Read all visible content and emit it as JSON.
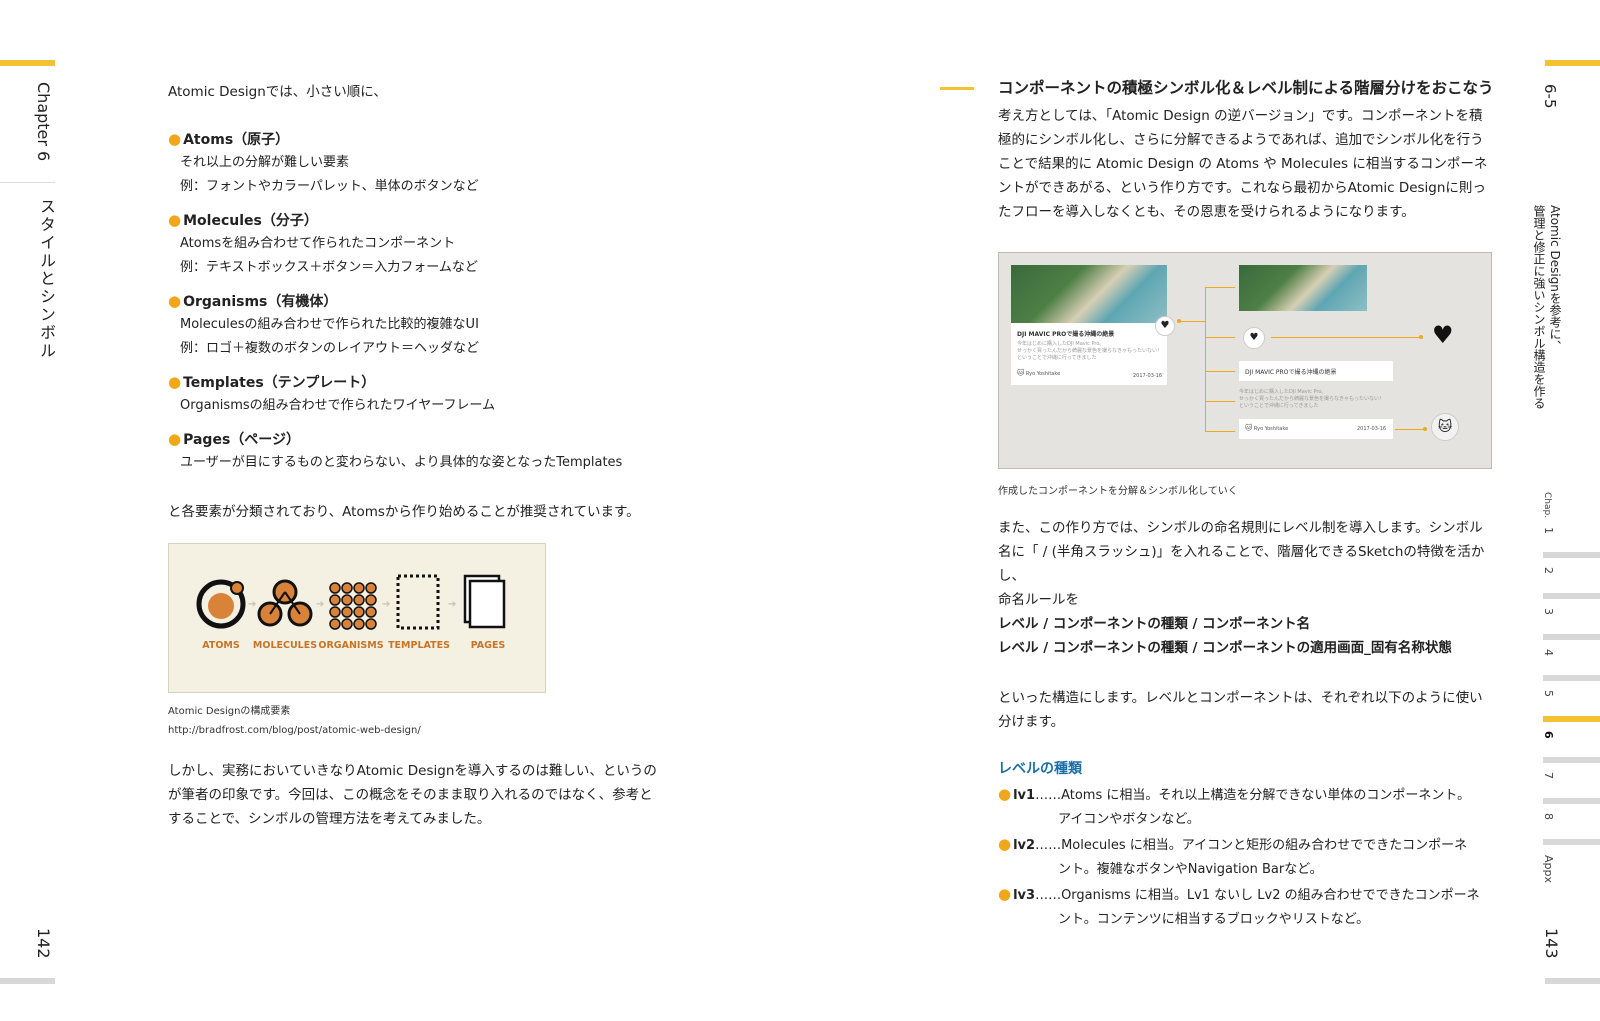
{
  "left_margin": {
    "chapter_label": "Chapter 6",
    "chapter_title": "スタイルとシンボル",
    "page_number": "142"
  },
  "left_page": {
    "intro": "Atomic Designでは、小さい順に、",
    "items": [
      {
        "head": "Atoms（原子）",
        "lines": [
          "それ以上の分解が難しい要素",
          "例：フォントやカラーパレット、単体のボタンなど"
        ]
      },
      {
        "head": "Molecules（分子）",
        "lines": [
          "Atomsを組み合わせて作られたコンポーネント",
          "例：テキストボックス＋ボタン＝入力フォームなど"
        ]
      },
      {
        "head": "Organisms（有機体）",
        "lines": [
          "Moleculesの組み合わせで作られた比較的複雑なUI",
          "例：ロゴ＋複数のボタンのレイアウト＝ヘッダなど"
        ]
      },
      {
        "head": "Templates（テンプレート）",
        "lines": [
          "Organismsの組み合わせで作られたワイヤーフレーム"
        ]
      },
      {
        "head": "Pages（ページ）",
        "lines": [
          "ユーザーが目にするものと変わらない、より具体的な姿となったTemplates"
        ]
      }
    ],
    "summary": "と各要素が分類されており、Atomsから作り始めることが推奨されています。",
    "figure_labels": [
      "ATOMS",
      "MOLECULES",
      "ORGANISMS",
      "TEMPLATES",
      "PAGES"
    ],
    "caption_1": "Atomic Designの構成要素",
    "caption_2": "http://bradfrost.com/blog/post/atomic-web-design/",
    "closing": [
      "しかし、実務においていきなりAtomic Designを導入するのは難しい、というの",
      "が筆者の印象です。今回は、この概念をそのまま取り入れるのではなく、参考と",
      "することで、シンボルの管理方法を考えてみました。"
    ]
  },
  "right_page": {
    "heading": "コンポーネントの積極シンボル化＆レベル制による階層分けをおこなう",
    "para1": [
      "考え方としては、「Atomic Design の逆バージョン」です。コンポーネントを積",
      "極的にシンボル化し、さらに分解できるようであれば、追加でシンボル化を行う",
      "ことで結果的に Atomic Design の Atoms や Molecules に相当するコンポーネ",
      "ントができあがる、という作り方です。これなら最初からAtomic Designに則っ",
      "たフローを導入しなくとも、その恩恵を受けられるようになります。"
    ],
    "figure": {
      "card_title": "DJI MAVIC PROで撮る沖縄の絶景",
      "card_body": [
        "今年はじめに購入したDJI Mavic Pro。",
        "せっかく買ったんだから綺麗な景色を撮らなきゃもったいない！",
        "ということで沖縄に行ってきました"
      ],
      "author": "Ryo Yoshitake",
      "date": "2017-03-16"
    },
    "fig_caption": "作成したコンポーネントを分解＆シンボル化していく",
    "para2": [
      "また、この作り方では、シンボルの命名規則にレベル制を導入します。シンボル",
      "名に「 / (半角スラッシュ)」を入れることで、階層化できるSketchの特徴を活かし、",
      "命名ルールを"
    ],
    "naming": [
      "レベル / コンポーネントの種類 / コンポーネント名",
      "レベル / コンポーネントの種類 / コンポーネントの適用画面_固有名称状態"
    ],
    "para3": [
      "といった構造にします。レベルとコンポーネントは、それぞれ以下のように使い",
      "分けます。"
    ],
    "levels_heading": "レベルの種類",
    "levels": [
      {
        "key": "lv1",
        "lines": [
          "……Atoms に相当。それ以上構造を分解できない単体のコンポーネント。",
          "アイコンやボタンなど。"
        ]
      },
      {
        "key": "lv2",
        "lines": [
          "……Molecules に相当。アイコンと矩形の組み合わせでできたコンポーネ",
          "ント。複雑なボタンやNavigation Barなど。"
        ]
      },
      {
        "key": "lv3",
        "lines": [
          "……Organisms に相当。Lv1 ないし Lv2 の組み合わせでできたコンポーネ",
          "ント。コンテンツに相当するブロックやリストなど。"
        ]
      }
    ]
  },
  "right_margin": {
    "section": "6-5",
    "title": [
      "Atomic Designを参考に、",
      "管理と修正に強いシンボル構造を作る"
    ],
    "chap_label": "Chap.",
    "chapters": [
      "1",
      "2",
      "3",
      "4",
      "5",
      "6",
      "7",
      "8",
      "Appx"
    ],
    "active_chapter": "6",
    "page_number": "143"
  },
  "colors": {
    "accent": "#f3c233",
    "bullet": "#f0a81a",
    "blue_heading": "#1a6fa8",
    "figure_orange": "#c77427"
  }
}
